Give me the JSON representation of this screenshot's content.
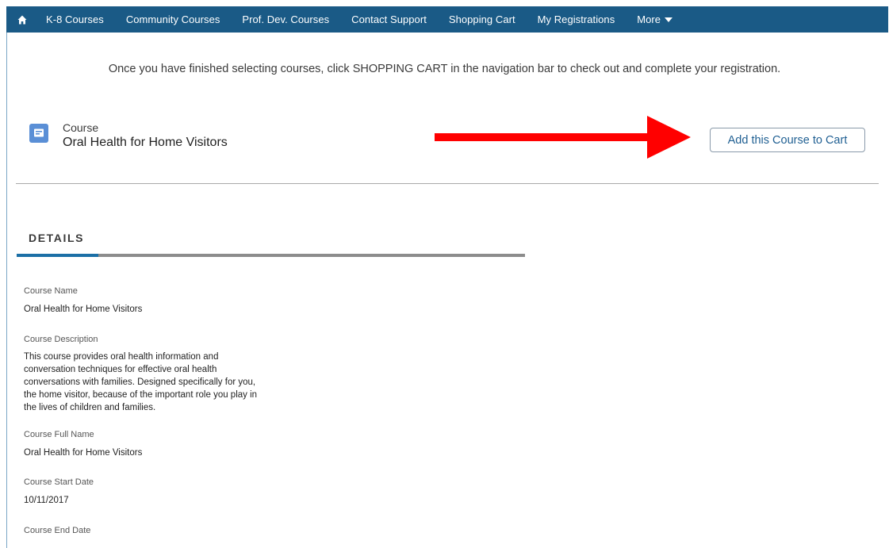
{
  "nav": {
    "home_icon": "home-icon",
    "items": [
      "K-8 Courses",
      "Community Courses",
      "Prof. Dev. Courses",
      "Contact Support",
      "Shopping Cart",
      "My Registrations"
    ],
    "more_label": "More",
    "more_icon": "caret-down-icon",
    "background_color": "#1a5a86"
  },
  "instruction": "Once you have finished selecting courses, click SHOPPING CART in the navigation bar to check out and complete your registration.",
  "record": {
    "icon": "course-record-icon",
    "type_label": "Course",
    "title": "Oral Health for Home Visitors",
    "add_button_label": "Add this Course to Cart"
  },
  "annotation": {
    "arrow_icon": "red-arrow-icon",
    "arrow_color": "#ff0000"
  },
  "details": {
    "heading": "DETAILS",
    "fields": [
      {
        "label": "Course Name",
        "value": "Oral Health for Home Visitors"
      },
      {
        "label": "Course Description",
        "value": "This course provides oral health information and conversation techniques for effective oral health conversations with families. Designed specifically for you, the home visitor, because of the important role you play in the lives of children and families."
      },
      {
        "label": "Course Full Name",
        "value": "Oral Health for Home Visitors"
      },
      {
        "label": "Course Start Date",
        "value": "10/11/2017"
      },
      {
        "label": "Course End Date",
        "value": ""
      }
    ]
  }
}
